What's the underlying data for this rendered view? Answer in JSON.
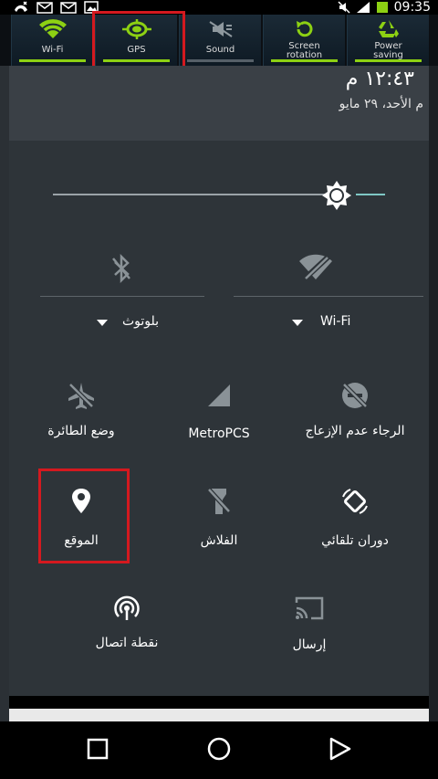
{
  "status_bar": {
    "clock": "09:35",
    "icons": [
      "missed-call-icon",
      "mail-icon",
      "mail-icon",
      "image-icon",
      "mute-icon",
      "signal-icon",
      "battery-icon"
    ]
  },
  "toggles": [
    {
      "label": "Wi-Fi",
      "icon": "wifi-icon",
      "active": true
    },
    {
      "label": "GPS",
      "icon": "gps-icon",
      "active": true
    },
    {
      "label": "Sound",
      "icon": "sound-off-icon",
      "active": false
    },
    {
      "label": "Screen\nrotation",
      "icon": "rotation-icon",
      "active": true
    },
    {
      "label": "Power\nsaving",
      "icon": "recycle-icon",
      "active": true
    }
  ],
  "header": {
    "time": "١٢:٤٣ م",
    "date": "م الأحد، ٢٩ مايو"
  },
  "quick_settings": {
    "brightness_level": 0.91,
    "wifi": {
      "label": "Wi-Fi",
      "icon": "wifi-off-icon"
    },
    "bluetooth": {
      "label": "بلوتوث",
      "icon": "bluetooth-off-icon"
    },
    "tiles": [
      {
        "label": "الرجاء عدم الإزعاج",
        "icon": "do-not-disturb-icon"
      },
      {
        "label": "MetroPCS",
        "icon": "cell-signal-icon"
      },
      {
        "label": "وضع الطائرة",
        "icon": "airplane-mode-icon"
      },
      {
        "label": "دوران تلقائي",
        "icon": "auto-rotate-icon"
      },
      {
        "label": "الفلاش",
        "icon": "flashlight-off-icon"
      },
      {
        "label": "الموقع",
        "icon": "location-icon"
      },
      {
        "label": "إرسال",
        "icon": "cast-icon"
      },
      {
        "label": "نقطة اتصال",
        "icon": "hotspot-icon"
      }
    ]
  },
  "colors": {
    "highlight": "#d4191f",
    "toggle_on": "#8dd113",
    "panel": "#2e3439"
  }
}
